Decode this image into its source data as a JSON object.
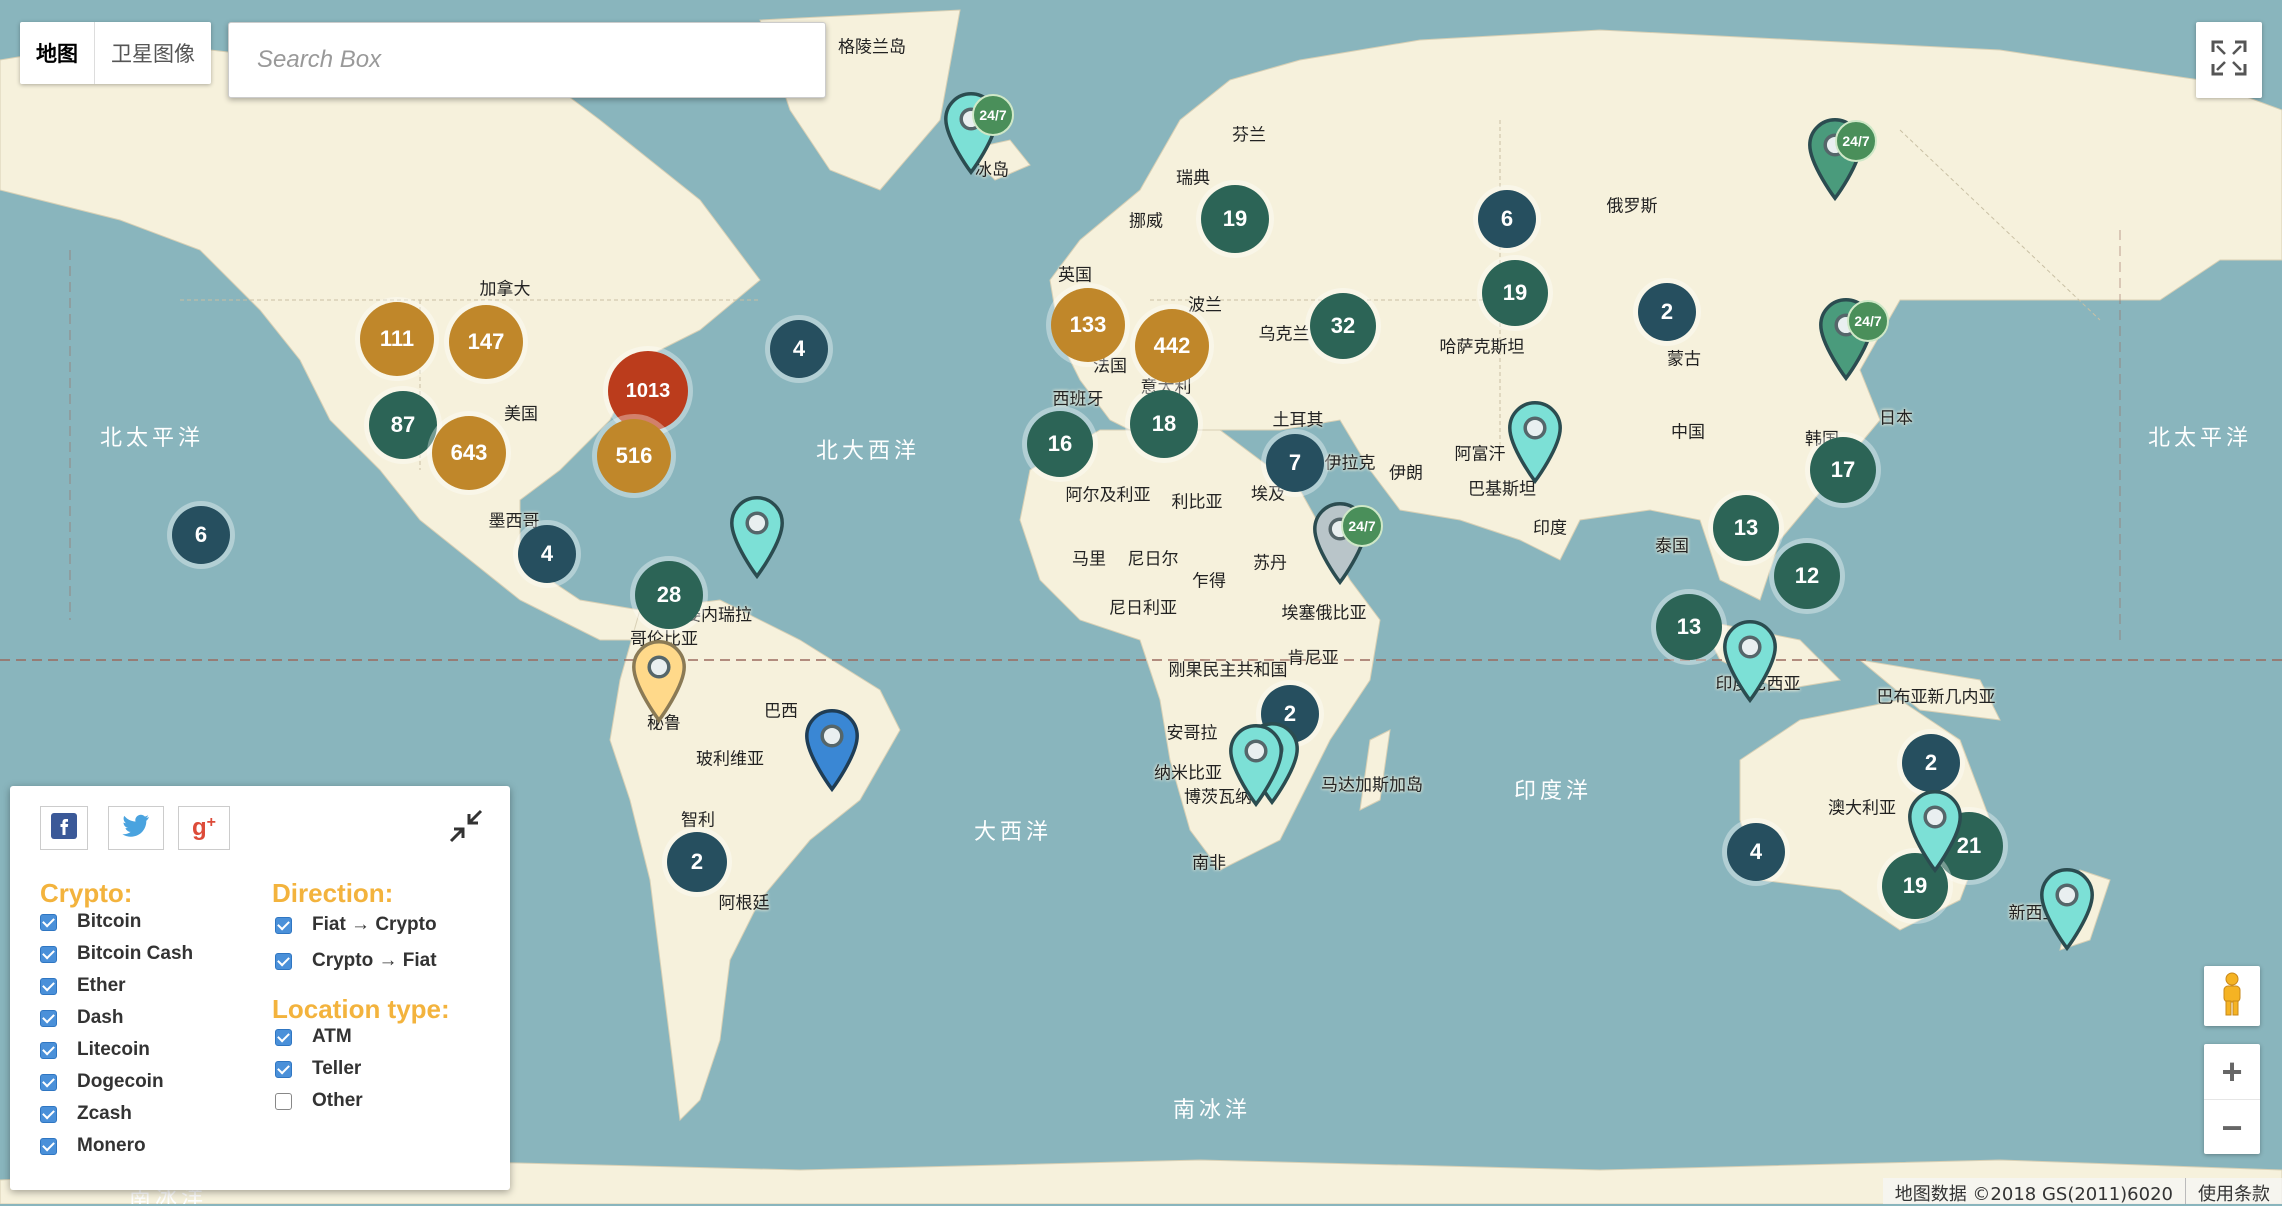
{
  "map_type": {
    "map_label": "地图",
    "satellite_label": "卫星图像"
  },
  "search": {
    "placeholder": "Search Box"
  },
  "icons": {
    "fullscreen": "fullscreen-icon",
    "pegman": "pegman-icon",
    "zoom_in": "plus-icon",
    "zoom_out": "minus-icon",
    "collapse": "collapse-icon"
  },
  "zoom": {
    "in_label": "+",
    "out_label": "−"
  },
  "attribution": {
    "data": "地图数据 ©2018 GS(2011)6020",
    "terms": "使用条款"
  },
  "social": {
    "facebook": "facebook-icon",
    "twitter": "twitter-icon",
    "google_plus": "google-plus-icon"
  },
  "filters": {
    "crypto_title": "Crypto:",
    "crypto": [
      {
        "label": "Bitcoin",
        "checked": true
      },
      {
        "label": "Bitcoin Cash",
        "checked": true
      },
      {
        "label": "Ether",
        "checked": true
      },
      {
        "label": "Dash",
        "checked": true
      },
      {
        "label": "Litecoin",
        "checked": true
      },
      {
        "label": "Dogecoin",
        "checked": true
      },
      {
        "label": "Zcash",
        "checked": true
      },
      {
        "label": "Monero",
        "checked": true
      }
    ],
    "direction_title": "Direction:",
    "direction": [
      {
        "label": "Fiat → Crypto",
        "checked": true
      },
      {
        "label": "Crypto → Fiat",
        "checked": true
      }
    ],
    "location_title": "Location type:",
    "location": [
      {
        "label": "ATM",
        "checked": true
      },
      {
        "label": "Teller",
        "checked": true
      },
      {
        "label": "Other",
        "checked": false
      }
    ]
  },
  "map_labels": {
    "oceans": [
      "北太平洋",
      "北大西洋",
      "北太平洋",
      "大西洋",
      "印度洋",
      "南冰洋",
      "南冰洋"
    ],
    "places": [
      "格陵兰岛",
      "冰岛",
      "芬兰",
      "瑞典",
      "挪威",
      "俄罗斯",
      "英国",
      "波兰",
      "乌克兰",
      "哈萨克斯坦",
      "蒙古",
      "加拿大",
      "美国",
      "墨西哥",
      "法国",
      "意大利",
      "西班牙",
      "土耳其",
      "伊拉克",
      "伊朗",
      "阿富汗",
      "巴基斯坦",
      "中国",
      "韩国",
      "日本",
      "印度",
      "泰国",
      "阿尔及利亚",
      "利比亚",
      "埃及",
      "马里",
      "尼日尔",
      "乍得",
      "苏丹",
      "尼日利亚",
      "埃塞俄比亚",
      "刚果民主共和国",
      "肯尼亚",
      "安哥拉",
      "纳米比亚",
      "博茨瓦纳",
      "南非",
      "马达加斯加岛",
      "委内瑞拉",
      "哥伦比亚",
      "秘鲁",
      "巴西",
      "玻利维亚",
      "智利",
      "阿根廷",
      "印度尼西亚",
      "巴布亚新几内亚",
      "澳大利亚",
      "新西兰"
    ]
  },
  "clusters": [
    {
      "count": "111",
      "tier": "orange"
    },
    {
      "count": "147",
      "tier": "orange"
    },
    {
      "count": "1013",
      "tier": "red"
    },
    {
      "count": "87",
      "tier": "green"
    },
    {
      "count": "643",
      "tier": "orange"
    },
    {
      "count": "516",
      "tier": "orange"
    },
    {
      "count": "6",
      "tier": "teal"
    },
    {
      "count": "4",
      "tier": "teal"
    },
    {
      "count": "4",
      "tier": "teal"
    },
    {
      "count": "28",
      "tier": "green"
    },
    {
      "count": "2",
      "tier": "teal"
    },
    {
      "count": "19",
      "tier": "green"
    },
    {
      "count": "133",
      "tier": "orange"
    },
    {
      "count": "442",
      "tier": "orange"
    },
    {
      "count": "16",
      "tier": "green"
    },
    {
      "count": "18",
      "tier": "green"
    },
    {
      "count": "32",
      "tier": "green"
    },
    {
      "count": "6",
      "tier": "teal"
    },
    {
      "count": "19",
      "tier": "green"
    },
    {
      "count": "2",
      "tier": "teal"
    },
    {
      "count": "7",
      "tier": "teal"
    },
    {
      "count": "2",
      "tier": "teal"
    },
    {
      "count": "17",
      "tier": "green"
    },
    {
      "count": "13",
      "tier": "green"
    },
    {
      "count": "12",
      "tier": "green"
    },
    {
      "count": "13",
      "tier": "green"
    },
    {
      "count": "2",
      "tier": "teal"
    },
    {
      "count": "4",
      "tier": "teal"
    },
    {
      "count": "21",
      "tier": "green"
    },
    {
      "count": "19",
      "tier": "green"
    }
  ],
  "badge_text": "24/7",
  "colors": {
    "ocean": "#89b5bd",
    "land": "#f6f1dc",
    "orange": "#c0872a",
    "red": "#bb3c1c",
    "green": "#2c6456",
    "teal": "#264f5f",
    "pin_cyan": "#7ce0d6",
    "pin_green": "#4a9b7c",
    "pin_blue": "#3a87d4",
    "pin_yellow": "#ffd98a",
    "pin_gray": "#b9c5c9",
    "accent": "#f3b33d"
  }
}
